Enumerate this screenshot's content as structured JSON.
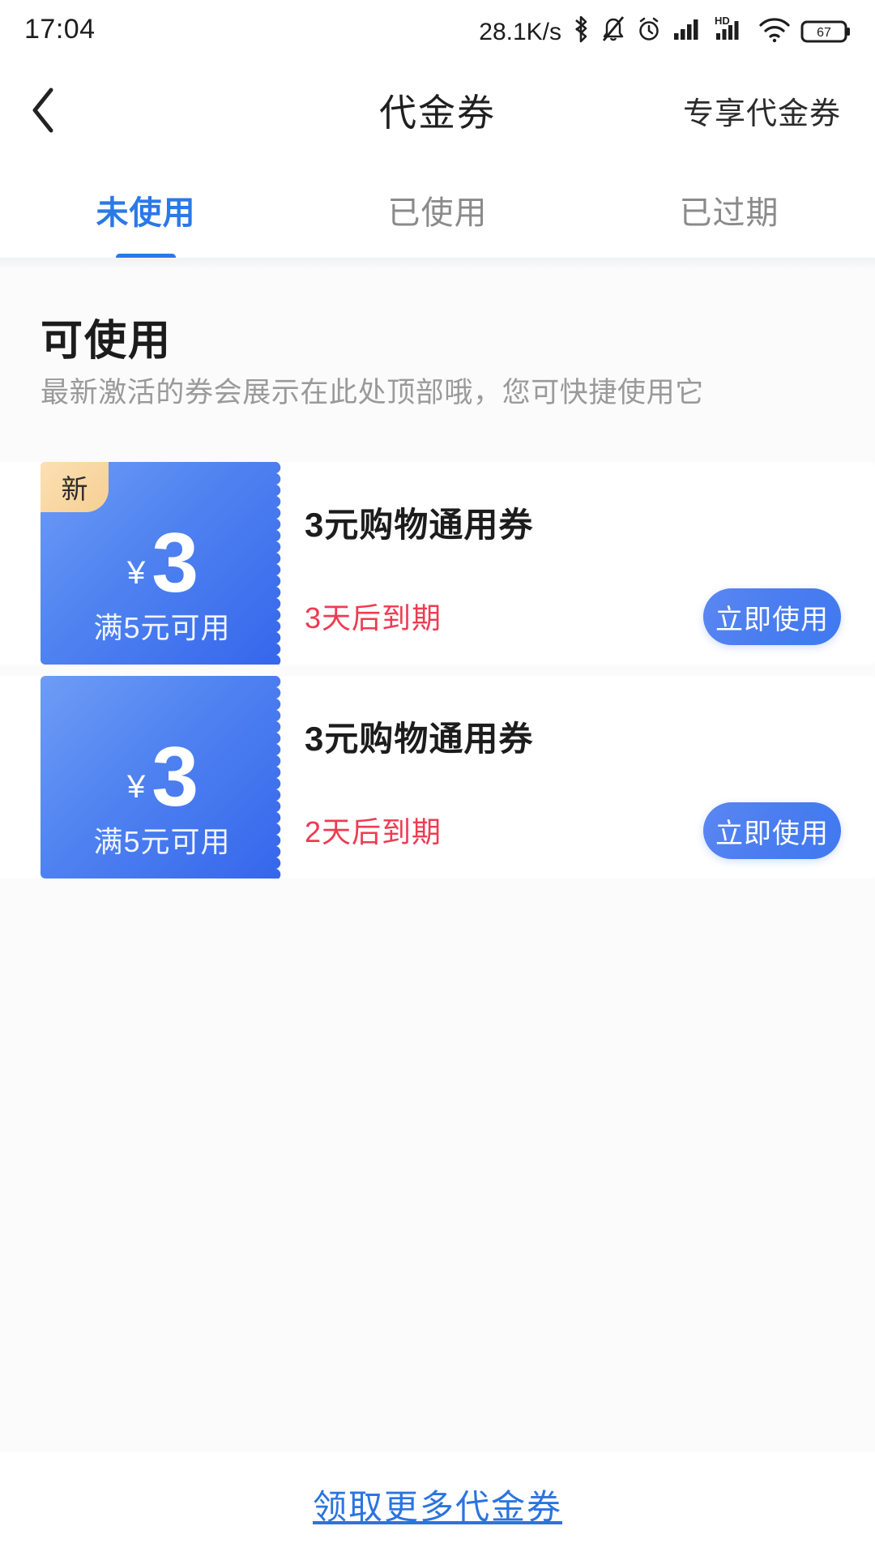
{
  "status_bar": {
    "time": "17:04",
    "network_speed": "28.1K/s",
    "battery_level": "67",
    "icons": [
      "bluetooth-icon",
      "mute-icon",
      "alarm-icon",
      "signal-icon",
      "hd-icon",
      "signal-icon-2",
      "wifi-icon",
      "battery-icon"
    ]
  },
  "header": {
    "back_icon": "chevron-left-icon",
    "title": "代金券",
    "action_label": "专享代金券"
  },
  "tabs": [
    {
      "label": "未使用",
      "active": true
    },
    {
      "label": "已使用",
      "active": false
    },
    {
      "label": "已过期",
      "active": false
    }
  ],
  "section": {
    "title": "可使用",
    "description": "最新激活的券会展示在此处顶部哦，您可快捷使用它"
  },
  "coupons": [
    {
      "badge": "新",
      "has_badge": true,
      "currency": "¥",
      "amount": "3",
      "condition": "满5元可用",
      "title": "3元购物通用券",
      "expiry": "3天后到期",
      "button_label": "立即使用"
    },
    {
      "badge": "",
      "has_badge": false,
      "currency": "¥",
      "amount": "3",
      "condition": "满5元可用",
      "title": "3元购物通用券",
      "expiry": "2天后到期",
      "button_label": "立即使用"
    }
  ],
  "footer": {
    "link_label": "领取更多代金券"
  },
  "colors": {
    "accent_blue": "#2979e8",
    "coupon_blue": "#4f82f0",
    "expiry_red": "#ef3b52",
    "badge_orange": "#f6cf93",
    "footer_link": "#2b74e0"
  }
}
